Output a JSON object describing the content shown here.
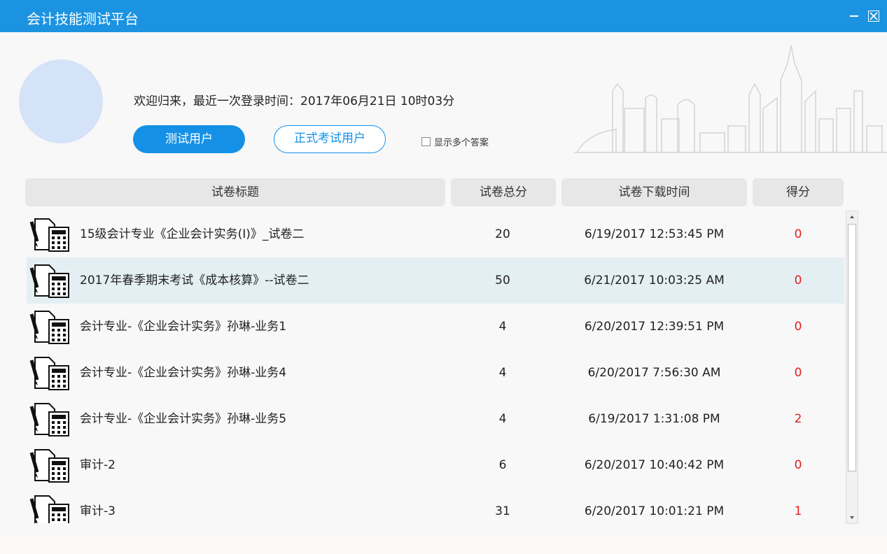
{
  "window": {
    "title": "会计技能测试平台"
  },
  "header": {
    "welcome": "欢迎归来，最近一次登录时间：2017年06月21日 10时03分",
    "btn_test": "测试用户",
    "btn_formal": "正式考试用户",
    "show_multi_answers": "显示多个答案"
  },
  "table": {
    "columns": [
      "试卷标题",
      "试卷总分",
      "试卷下载时间",
      "得分"
    ],
    "rows": [
      {
        "title": "15级会计专业《企业会计实务(I)》_试卷二",
        "total": "20",
        "time": "6/19/2017 12:53:45 PM",
        "score": "0"
      },
      {
        "title": "2017年春季期末考试《成本核算》--试卷二",
        "total": "50",
        "time": "6/21/2017 10:03:25 AM",
        "score": "0"
      },
      {
        "title": "会计专业-《企业会计实务》孙琳-业务1",
        "total": "4",
        "time": "6/20/2017 12:39:51 PM",
        "score": "0"
      },
      {
        "title": "会计专业-《企业会计实务》孙琳-业务4",
        "total": "4",
        "time": "6/20/2017 7:56:30 AM",
        "score": "0"
      },
      {
        "title": "会计专业-《企业会计实务》孙琳-业务5",
        "total": "4",
        "time": "6/19/2017 1:31:08 PM",
        "score": "2"
      },
      {
        "title": "审计-2",
        "total": "6",
        "time": "6/20/2017 10:40:42 PM",
        "score": "0"
      },
      {
        "title": "审计-3",
        "total": "31",
        "time": "6/20/2017 10:01:21 PM",
        "score": "1"
      }
    ]
  },
  "colors": {
    "accent": "#1491e6",
    "titlebar": "#1c93e0",
    "score": "#e02020",
    "selected_row": "#e4eff3"
  },
  "icons": {
    "row_icon": "exam-calculator-icon",
    "skyline": "city-skyline-icon"
  }
}
